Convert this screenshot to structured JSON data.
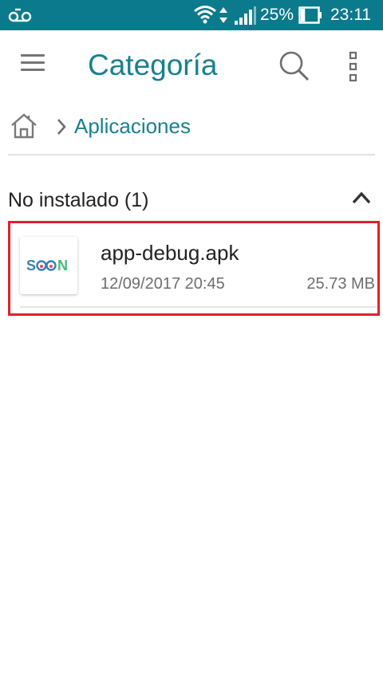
{
  "status_bar": {
    "battery_percent": "25%",
    "time": "23:11",
    "battery_level": 0.25,
    "icons": [
      "voicemail-icon",
      "wifi-icon",
      "data-arrows-icon",
      "signal-icon",
      "battery-icon"
    ]
  },
  "app_bar": {
    "title": "Categoría",
    "menu_icon": "hamburger-menu-icon",
    "search_icon": "search-icon",
    "more_icon": "more-vert-icon"
  },
  "breadcrumb": {
    "home_icon": "home-icon",
    "current": "Aplicaciones"
  },
  "section": {
    "title": "No instalado (1)",
    "collapse_icon": "chevron-up-icon"
  },
  "files": [
    {
      "name": "app-debug.apk",
      "date": "12/09/2017 20:45",
      "size": "25.73 MB",
      "icon_text": "SOON"
    }
  ],
  "colors": {
    "status_bar": "#0b7a8c",
    "accent": "#18808f",
    "highlight_border": "#e2202b"
  }
}
